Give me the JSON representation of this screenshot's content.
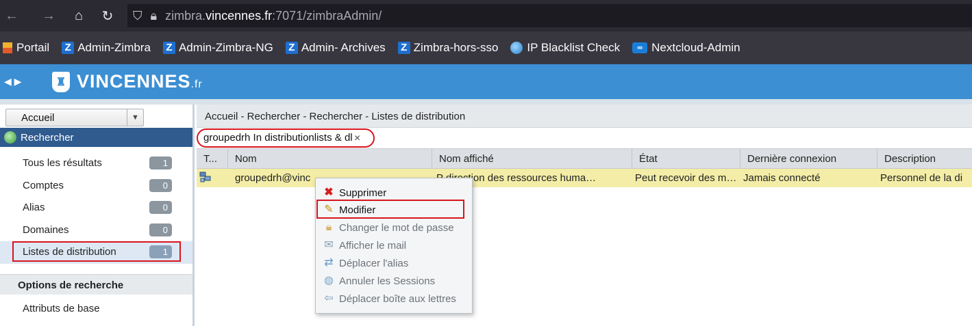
{
  "browser": {
    "url_prefix": "zimbra.",
    "url_domain": "vincennes.fr",
    "url_suffix": ":7071/zimbraAdmin/"
  },
  "bookmarks": [
    {
      "label": "Portail",
      "icon": "portail-icon"
    },
    {
      "label": "Admin-Zimbra",
      "icon": "zimbra-icon"
    },
    {
      "label": "Admin-Zimbra-NG",
      "icon": "zimbra-icon"
    },
    {
      "label": "Admin- Archives",
      "icon": "zimbra-icon"
    },
    {
      "label": "Zimbra-hors-sso",
      "icon": "zimbra-icon"
    },
    {
      "label": "IP Blacklist Check",
      "icon": "globe-icon"
    },
    {
      "label": "Nextcloud-Admin",
      "icon": "nextcloud-icon"
    }
  ],
  "app": {
    "logo_main": "VINCENNES",
    "logo_tld": ".fr",
    "header_color": "#3c8fd3"
  },
  "left": {
    "dropdown_value": "Accueil",
    "selected": "Rechercher",
    "results": [
      {
        "label": "Tous les résultats",
        "count": "1"
      },
      {
        "label": "Comptes",
        "count": "0"
      },
      {
        "label": "Alias",
        "count": "0"
      },
      {
        "label": "Domaines",
        "count": "0"
      },
      {
        "label": "Listes de distribution",
        "count": "1"
      }
    ],
    "options_header": "Options de recherche",
    "options_item": "Attributs de base"
  },
  "right": {
    "breadcrumb": "Accueil - Rechercher - Rechercher - Listes de distribution",
    "search_chip": "groupedrh In distributionlists & dl",
    "columns": [
      "T...",
      "Nom",
      "Nom affiché",
      "État",
      "Dernière connexion",
      "Description"
    ],
    "row": {
      "nom": "groupedrh@vinc",
      "nom_affiche": "P direction des ressources huma…",
      "etat": "Peut recevoir des m…",
      "derniere_connexion": "Jamais connecté",
      "description": "Personnel de la di"
    }
  },
  "context_menu": [
    {
      "label": "Supprimer",
      "icon": "delete-icon",
      "enabled": true
    },
    {
      "label": "Modifier",
      "icon": "pencil-icon",
      "enabled": true
    },
    {
      "label": "Changer le mot de passe",
      "icon": "lock-icon",
      "enabled": false
    },
    {
      "label": "Afficher le mail",
      "icon": "mail-icon",
      "enabled": false
    },
    {
      "label": "Déplacer l'alias",
      "icon": "move-alias-icon",
      "enabled": false
    },
    {
      "label": "Annuler les Sessions",
      "icon": "sessions-icon",
      "enabled": false
    },
    {
      "label": "Déplacer boîte aux lettres",
      "icon": "move-mailbox-icon",
      "enabled": false
    }
  ],
  "colors": {
    "highlight": "#d8141e",
    "selected_row": "#f3eda7",
    "selected_left": "#2f5b8f"
  }
}
